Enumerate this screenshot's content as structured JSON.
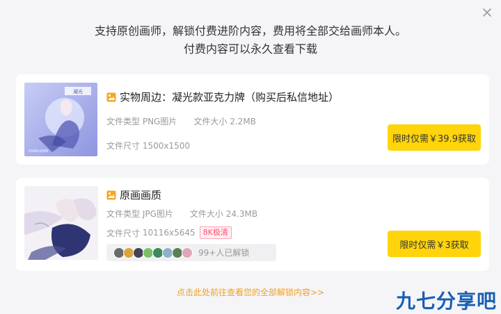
{
  "header": {
    "line1": "支持原创画师，解锁付费进阶内容，费用将全部交给画师本人。",
    "line2": "付费内容可以永久查看下载"
  },
  "icons": {
    "close": "close-icon",
    "image_type": "image-icon"
  },
  "items": [
    {
      "title": "实物周边：凝光款亚克力牌（购买后私信地址）",
      "file_type_label": "文件类型",
      "file_type": "PNG图片",
      "file_size_label": "文件大小",
      "file_size": "2.2MB",
      "dimensions_label": "文件尺寸",
      "dimensions": "1500x1500",
      "button": "限时仅需￥39.9获取",
      "thumb_texts": [
        "凝光",
        "1500x1500"
      ]
    },
    {
      "title": "原画画质",
      "file_type_label": "文件类型",
      "file_type": "JPG图片",
      "file_size_label": "文件大小",
      "file_size": "24.3MB",
      "dimensions_label": "文件尺寸",
      "dimensions": "10116x5645",
      "badge": "8K极清",
      "unlock_count": "99+人已解锁",
      "button": "限时仅需￥3获取"
    }
  ],
  "footer": {
    "link": "点击此处前往查看您的全部解锁内容>>"
  },
  "watermark": "九七分享吧",
  "colors": {
    "accent_button": "#ffd40a",
    "badge_text": "#ff4d6d",
    "link": "#f0a020",
    "image_icon": "#f5a623",
    "watermark": "#1a5fb4"
  }
}
